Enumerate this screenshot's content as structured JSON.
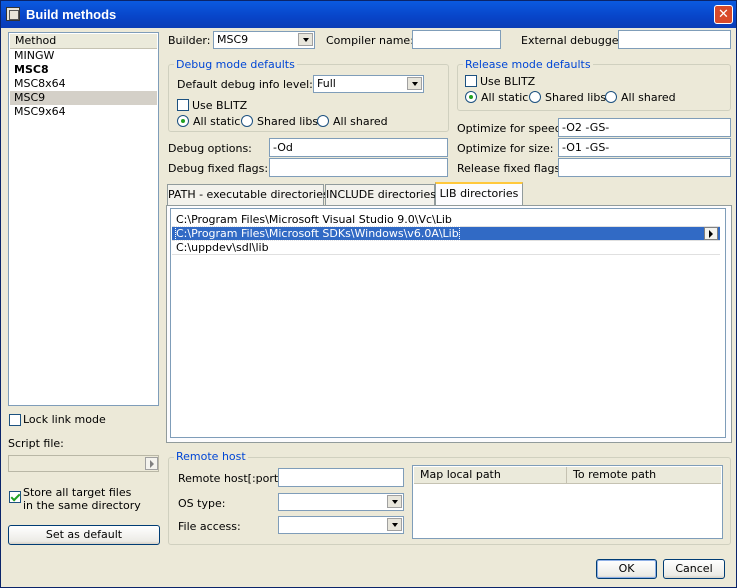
{
  "window": {
    "title": "Build methods",
    "close_glyph": "✕"
  },
  "methods": {
    "header": "Method",
    "items": [
      {
        "label": "MINGW",
        "bold": false,
        "selected": false
      },
      {
        "label": "MSC8",
        "bold": true,
        "selected": false
      },
      {
        "label": "MSC8x64",
        "bold": false,
        "selected": false
      },
      {
        "label": "MSC9",
        "bold": false,
        "selected": true
      },
      {
        "label": "MSC9x64",
        "bold": false,
        "selected": false
      }
    ]
  },
  "builder": {
    "label": "Builder:",
    "value": "MSC9"
  },
  "compiler": {
    "label": "Compiler name:",
    "value": ""
  },
  "debugger": {
    "label": "External debugger:",
    "value": ""
  },
  "debug_defaults": {
    "title": "Debug mode defaults",
    "info_level_label": "Default debug info level:",
    "info_level_value": "Full",
    "use_blitz": "Use BLITZ",
    "use_blitz_checked": false,
    "radios": [
      "All static",
      "Shared libs",
      "All shared"
    ],
    "selected_index": 0
  },
  "release_defaults": {
    "title": "Release mode defaults",
    "use_blitz": "Use BLITZ",
    "use_blitz_checked": false,
    "radios": [
      "All static",
      "Shared libs",
      "All shared"
    ],
    "selected_index": 0
  },
  "options": {
    "optimize_speed_label": "Optimize for speed:",
    "optimize_speed_value": "-O2 -GS-",
    "optimize_size_label": "Optimize for size:",
    "optimize_size_value": "-O1 -GS-",
    "debug_options_label": "Debug options:",
    "debug_options_value": "-Od",
    "debug_fixed_label": "Debug fixed flags:",
    "debug_fixed_value": "",
    "release_fixed_label": "Release fixed flags:",
    "release_fixed_value": ""
  },
  "tabs": {
    "items": [
      "PATH - executable directories",
      "INCLUDE directories",
      "LIB directories"
    ],
    "active_index": 2
  },
  "lib_dirs": [
    "C:\\Program Files\\Microsoft Visual Studio 9.0\\Vc\\Lib",
    "C:\\Program Files\\Microsoft SDKs\\Windows\\v6.0A\\Lib",
    "C:\\uppdev\\sdl\\lib"
  ],
  "lib_selected_index": 1,
  "lock_link": {
    "label": "Lock link mode",
    "checked": false
  },
  "script_file": {
    "label": "Script file:",
    "value": ""
  },
  "store_all": {
    "label_line1": "Store all target files",
    "label_line2": "in the same directory",
    "checked": true
  },
  "set_default_label": "Set as default",
  "remote": {
    "title": "Remote host",
    "host_label": "Remote host[:port]:",
    "host_value": "",
    "os_label": "OS type:",
    "os_value": "",
    "access_label": "File access:",
    "access_value": "",
    "columns": [
      "Map local path",
      "To remote path"
    ]
  },
  "ok_label": "OK",
  "cancel_label": "Cancel",
  "colors": {
    "accent": "#316ac5",
    "title_bar": "#0a5ae0",
    "group_title": "#0046d5",
    "check_mark": "#21a121"
  }
}
